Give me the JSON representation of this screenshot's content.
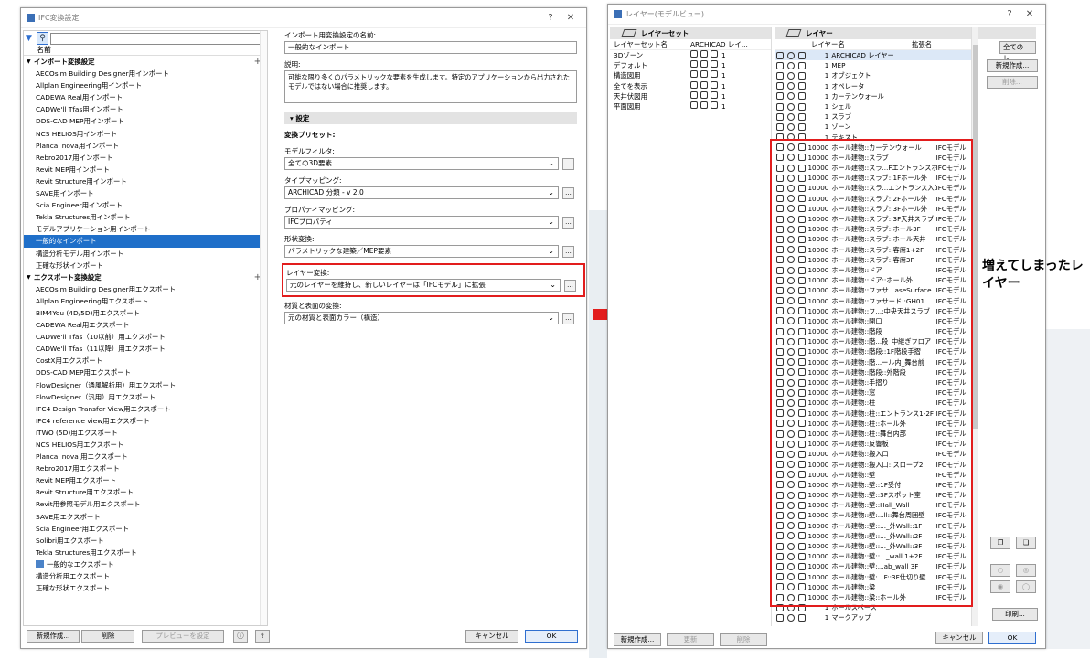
{
  "w1": {
    "title": "IFC変換設定",
    "help": "?",
    "close": "✕",
    "search_placeholder": "",
    "col_name": "名前",
    "import_group": "インポート変換設定",
    "import_items": [
      "AECOsim Building Designer用インポート",
      "Allplan Engineering用インポート",
      "CADEWA Real用インポート",
      "CADWe'll Tfas用インポート",
      "DDS-CAD MEP用インポート",
      "NCS HELIOS用インポート",
      "Plancal nova用インポート",
      "Rebro2017用インポート",
      "Revit MEP用インポート",
      "Revit Structure用インポート",
      "SAVE用インポート",
      "Scia Engineer用インポート",
      "Tekla Structures用インポート",
      "モデルアプリケーション用インポート",
      "一般的なインポート",
      "構造分析モデル用インポート",
      "正確な形状インポート"
    ],
    "selected_import": "一般的なインポート",
    "export_group": "エクスポート変換設定",
    "export_items": [
      "AECOsim Building Designer用エクスポート",
      "Allplan Engineering用エクスポート",
      "BIM4You (4D/5D)用エクスポート",
      "CADEWA Real用エクスポート",
      "CADWe'll Tfas（10以前）用エクスポート",
      "CADWe'll Tfas（11以降）用エクスポート",
      "CostX用エクスポート",
      "DDS-CAD MEP用エクスポート",
      "FlowDesigner（通風解析用）用エクスポート",
      "FlowDesigner（汎用）用エクスポート",
      "IFC4 Design Transfer View用エクスポート",
      "IFC4 reference view用エクスポート",
      "iTWO (5D)用エクスポート",
      "NCS HELIOS用エクスポート",
      "Plancal nova 用エクスポート",
      "Rebro2017用エクスポート",
      "Revit MEP用エクスポート",
      "Revit Structure用エクスポート",
      "Revit用参照モデル用エクスポート",
      "SAVE用エクスポート",
      "Scia Engineer用エクスポート",
      "Solibri用エクスポート",
      "Tekla Structures用エクスポート",
      "一般的なエクスポート",
      "構造分析用エクスポート",
      "正確な形状エクスポート"
    ],
    "name_label": "インポート用変換設定の名前:",
    "name_value": "一般的なインポート",
    "desc_label": "説明:",
    "desc_value": "可能な限り多くのパラメトリックな要素を生成します。特定のアプリケーションから出力されたモデルではない場合に推奨します。",
    "settings_header": "設定",
    "preset_label": "変換プリセット:",
    "model_filter_label": "モデルフィルタ:",
    "model_filter_value": "全ての3D要素",
    "type_mapping_label": "タイプマッピング:",
    "type_mapping_value": "ARCHICAD 分類 - v 2.0",
    "property_mapping_label": "プロパティマッピング:",
    "property_mapping_value": "IFCプロパティ",
    "geometry_label": "形状変換:",
    "geometry_value": "パラメトリックな建築／MEP要素",
    "layer_label": "レイヤー変換:",
    "layer_value": "元のレイヤーを維持し、新しいレイヤーは「IFCモデル」に拡張",
    "material_label": "材質と表面の変換:",
    "material_value": "元の材質と表面カラー（構造）",
    "btn_new": "新規作成...",
    "btn_delete": "削除",
    "btn_preview": "プレビューを設定",
    "btn_cancel": "キャンセル",
    "btn_ok": "OK"
  },
  "w2": {
    "title": "レイヤー(モデルビュー)",
    "help": "?",
    "close": "✕",
    "layer_sets_header": "レイヤーセット",
    "ls_col_name": "レイヤーセット名",
    "ls_col_archicad": "ARCHICAD レイ...",
    "layer_sets": [
      "3Dゾーン",
      "デフォルト",
      "構造図用",
      "全てを表示",
      "天井伏図用",
      "平面図用"
    ],
    "layers_header": "レイヤー",
    "col_layer_name": "レイヤー名",
    "col_ext": "拡張名",
    "layers": [
      {
        "n": "1",
        "name": "ARCHICAD レイヤー",
        "ext": ""
      },
      {
        "n": "1",
        "name": "MEP",
        "ext": ""
      },
      {
        "n": "1",
        "name": "オブジェクト",
        "ext": ""
      },
      {
        "n": "1",
        "name": "オペレータ",
        "ext": ""
      },
      {
        "n": "1",
        "name": "カーテンウォール",
        "ext": ""
      },
      {
        "n": "1",
        "name": "シェル",
        "ext": ""
      },
      {
        "n": "1",
        "name": "スラブ",
        "ext": ""
      },
      {
        "n": "1",
        "name": "ゾーン",
        "ext": ""
      },
      {
        "n": "1",
        "name": "テキスト",
        "ext": ""
      },
      {
        "n": "10000",
        "name": "ホール建物::カーテンウォール",
        "ext": "IFCモデル"
      },
      {
        "n": "10000",
        "name": "ホール建物::スラブ",
        "ext": "IFCモデル"
      },
      {
        "n": "10000",
        "name": "ホール建物::スラ...Fエントランスホ",
        "ext": "IFCモデル"
      },
      {
        "n": "10000",
        "name": "ホール建物::スラブ::1Fホール外",
        "ext": "IFCモデル"
      },
      {
        "n": "10000",
        "name": "ホール建物::スラ...エントランス入口",
        "ext": "IFCモデル"
      },
      {
        "n": "10000",
        "name": "ホール建物::スラブ::2Fホール外",
        "ext": "IFCモデル"
      },
      {
        "n": "10000",
        "name": "ホール建物::スラブ::3Fホール外",
        "ext": "IFCモデル"
      },
      {
        "n": "10000",
        "name": "ホール建物::スラブ::3F天井スラブ",
        "ext": "IFCモデル"
      },
      {
        "n": "10000",
        "name": "ホール建物::スラブ::ホール3F",
        "ext": "IFCモデル"
      },
      {
        "n": "10000",
        "name": "ホール建物::スラブ::ホール天井",
        "ext": "IFCモデル"
      },
      {
        "n": "10000",
        "name": "ホール建物::スラブ::客席1+2F",
        "ext": "IFCモデル"
      },
      {
        "n": "10000",
        "name": "ホール建物::スラブ::客席3F",
        "ext": "IFCモデル"
      },
      {
        "n": "10000",
        "name": "ホール建物::ドア",
        "ext": "IFCモデル"
      },
      {
        "n": "10000",
        "name": "ホール建物::ドア::ホール外",
        "ext": "IFCモデル"
      },
      {
        "n": "10000",
        "name": "ホール建物::ファサ...aseSurface",
        "ext": "IFCモデル"
      },
      {
        "n": "10000",
        "name": "ホール建物::ファサード::GH01",
        "ext": "IFCモデル"
      },
      {
        "n": "10000",
        "name": "ホール建物::フ...:中央天井スラブ",
        "ext": "IFCモデル"
      },
      {
        "n": "10000",
        "name": "ホール建物::開口",
        "ext": "IFCモデル"
      },
      {
        "n": "10000",
        "name": "ホール建物::階段",
        "ext": "IFCモデル"
      },
      {
        "n": "10000",
        "name": "ホール建物::階...段_中継ぎフロア",
        "ext": "IFCモデル"
      },
      {
        "n": "10000",
        "name": "ホール建物::階段::1F階段手摺",
        "ext": "IFCモデル"
      },
      {
        "n": "10000",
        "name": "ホール建物::階...ール内_舞台前",
        "ext": "IFCモデル"
      },
      {
        "n": "10000",
        "name": "ホール建物::階段::外階段",
        "ext": "IFCモデル"
      },
      {
        "n": "10000",
        "name": "ホール建物::手摺り",
        "ext": "IFCモデル"
      },
      {
        "n": "10000",
        "name": "ホール建物::窓",
        "ext": "IFCモデル"
      },
      {
        "n": "10000",
        "name": "ホール建物::柱",
        "ext": "IFCモデル"
      },
      {
        "n": "10000",
        "name": "ホール建物::柱::エントランス1-2F",
        "ext": "IFCモデル"
      },
      {
        "n": "10000",
        "name": "ホール建物::柱::ホール外",
        "ext": "IFCモデル"
      },
      {
        "n": "10000",
        "name": "ホール建物::柱::舞台内部",
        "ext": "IFCモデル"
      },
      {
        "n": "10000",
        "name": "ホール建物::反響板",
        "ext": "IFCモデル"
      },
      {
        "n": "10000",
        "name": "ホール建物::搬入口",
        "ext": "IFCモデル"
      },
      {
        "n": "10000",
        "name": "ホール建物::搬入口::スロープ2",
        "ext": "IFCモデル"
      },
      {
        "n": "10000",
        "name": "ホール建物::壁",
        "ext": "IFCモデル"
      },
      {
        "n": "10000",
        "name": "ホール建物::壁::1F受付",
        "ext": "IFCモデル"
      },
      {
        "n": "10000",
        "name": "ホール建物::壁::3Fスポット室",
        "ext": "IFCモデル"
      },
      {
        "n": "10000",
        "name": "ホール建物::壁::Hall_Wall",
        "ext": "IFCモデル"
      },
      {
        "n": "10000",
        "name": "ホール建物::壁:...ll::舞台周囲壁",
        "ext": "IFCモデル"
      },
      {
        "n": "10000",
        "name": "ホール建物::壁::..._外Wall::1F",
        "ext": "IFCモデル"
      },
      {
        "n": "10000",
        "name": "ホール建物::壁::..._外Wall::2F",
        "ext": "IFCモデル"
      },
      {
        "n": "10000",
        "name": "ホール建物::壁::..._外Wall::3F",
        "ext": "IFCモデル"
      },
      {
        "n": "10000",
        "name": "ホール建物::壁::..._wall 1+2F",
        "ext": "IFCモデル"
      },
      {
        "n": "10000",
        "name": "ホール建物::壁:...ab_wall 3F",
        "ext": "IFCモデル"
      },
      {
        "n": "10000",
        "name": "ホール建物::壁:...F::3F仕切り壁",
        "ext": "IFCモデル"
      },
      {
        "n": "10000",
        "name": "ホール建物::梁",
        "ext": "IFCモデル"
      },
      {
        "n": "10000",
        "name": "ホール建物::梁::ホール外",
        "ext": "IFCモデル"
      },
      {
        "n": "1",
        "name": "ホールスペース",
        "ext": ""
      },
      {
        "n": "1",
        "name": "マークアップ",
        "ext": ""
      }
    ],
    "filter_value": "全てのレ...",
    "btn_new_layer": "新規作成...",
    "btn_delete_layer": "削除...",
    "btn_new": "新規作成...",
    "btn_update": "更新",
    "btn_delete": "削除",
    "btn_print": "印刷...",
    "btn_cancel": "キャンセル",
    "btn_ok": "OK"
  },
  "annotation": "増えてしまったレイヤー",
  "colors": {
    "highlight": "#e21d1d",
    "selection": "#1f6fc9"
  }
}
